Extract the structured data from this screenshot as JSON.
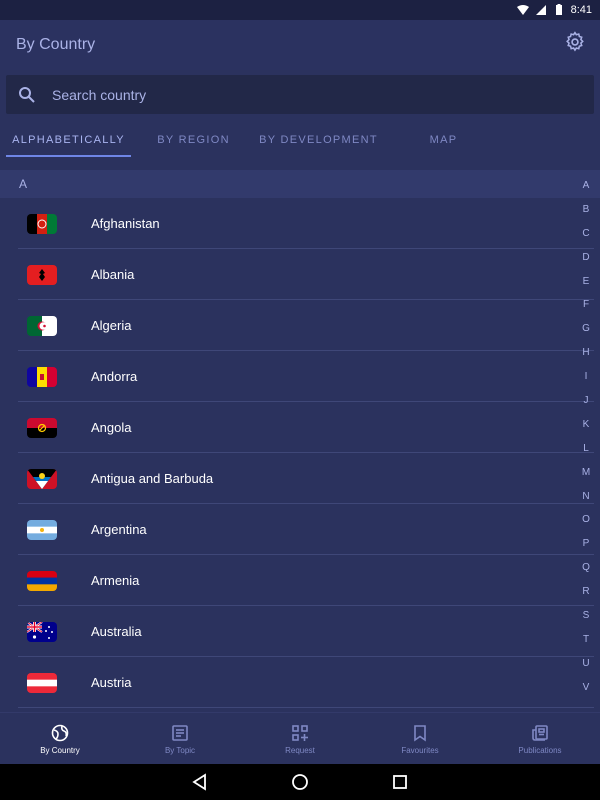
{
  "status": {
    "time": "8:41"
  },
  "app": {
    "title": "By Country"
  },
  "search": {
    "placeholder": "Search country"
  },
  "tabs": [
    {
      "label": "ALPHABETICALLY",
      "active": true
    },
    {
      "label": "BY REGION",
      "active": false
    },
    {
      "label": "BY DEVELOPMENT",
      "active": false
    },
    {
      "label": "MAP",
      "active": false
    }
  ],
  "section": {
    "letter": "A"
  },
  "countries": [
    {
      "name": "Afghanistan"
    },
    {
      "name": "Albania"
    },
    {
      "name": "Algeria"
    },
    {
      "name": "Andorra"
    },
    {
      "name": "Angola"
    },
    {
      "name": "Antigua and Barbuda"
    },
    {
      "name": "Argentina"
    },
    {
      "name": "Armenia"
    },
    {
      "name": "Australia"
    },
    {
      "name": "Austria"
    }
  ],
  "index_letters": [
    "A",
    "B",
    "C",
    "D",
    "E",
    "F",
    "G",
    "H",
    "I",
    "J",
    "K",
    "L",
    "M",
    "N",
    "O",
    "P",
    "Q",
    "R",
    "S",
    "T",
    "U",
    "V"
  ],
  "bottom_nav": [
    {
      "label": "By Country",
      "icon": "globe-icon",
      "active": true
    },
    {
      "label": "By Topic",
      "icon": "document-icon",
      "active": false
    },
    {
      "label": "Request",
      "icon": "request-grid-icon",
      "active": false
    },
    {
      "label": "Favourites",
      "icon": "bookmark-icon",
      "active": false
    },
    {
      "label": "Publications",
      "icon": "newspaper-icon",
      "active": false
    }
  ],
  "colors": {
    "background": "#2b325e",
    "accent": "#6f86e6",
    "muted_text": "#aab2e6"
  }
}
